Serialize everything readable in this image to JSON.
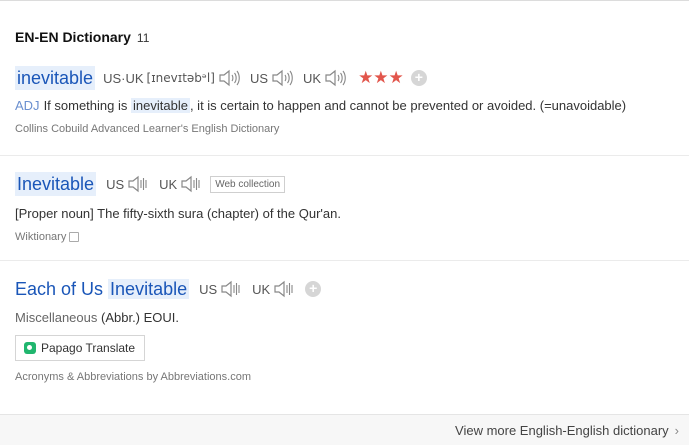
{
  "section": {
    "title": "EN-EN Dictionary",
    "count": "11"
  },
  "entries": [
    {
      "headword": "inevitable",
      "pron_label": "US·UK",
      "ipa": "[ɪnevɪtəbᵊl]",
      "region1": "US",
      "region2": "UK",
      "stars": "★★★",
      "pos": "ADJ",
      "def_before": "If something is",
      "def_highlight": "inevitable",
      "def_after": ", it is certain to happen and cannot be prevented or avoided. (=unavoidable)",
      "source": "Collins Cobuild Advanced Learner's English Dictionary"
    },
    {
      "headword": "Inevitable",
      "region1": "US",
      "region2": "UK",
      "badge": "Web collection",
      "def": "[Proper noun] The fifty-sixth sura (chapter) of the Qur'an.",
      "source": "Wiktionary"
    },
    {
      "headword_plain": "Each of Us ",
      "headword_hl": "Inevitable",
      "region1": "US",
      "region2": "UK",
      "misc": "Miscellaneous",
      "def": "(Abbr.) EOUI.",
      "papago": "Papago Translate",
      "source": "Acronyms & Abbreviations by Abbreviations.com"
    }
  ],
  "footer": {
    "view_more": "View more English-English dictionary"
  },
  "colors": {
    "link": "#1a56b8",
    "highlight": "#e6effb",
    "stars": "#e2564c",
    "pos": "#6a8fcf",
    "papago": "#20b66e"
  },
  "icons": [
    "speaker-icon",
    "plus-icon",
    "copy-icon",
    "papago-icon",
    "chevron-right-icon"
  ]
}
